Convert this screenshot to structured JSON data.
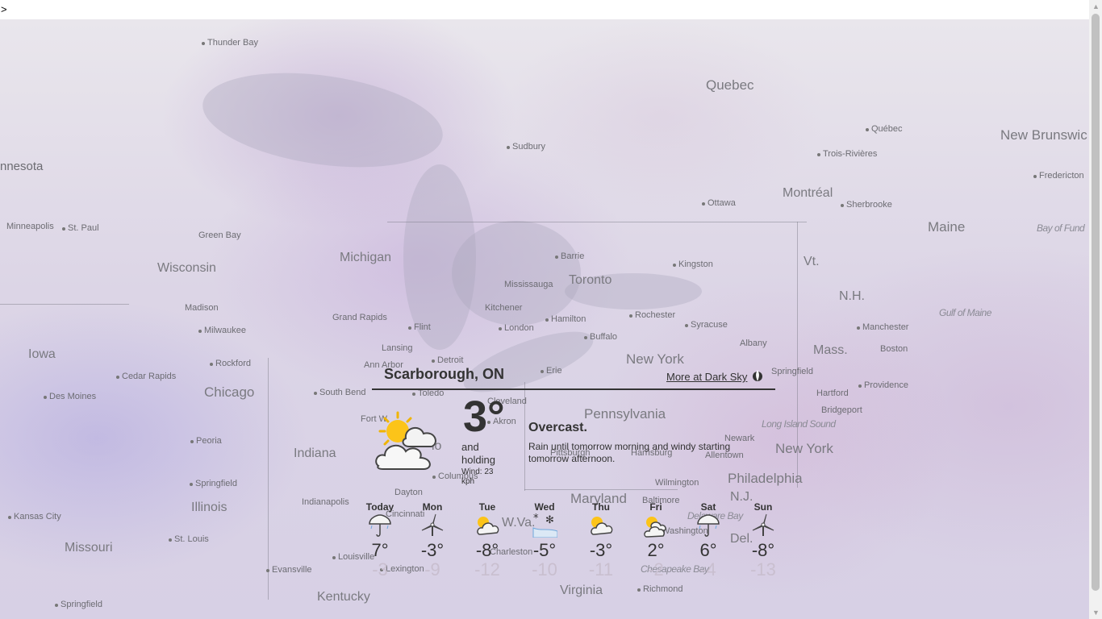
{
  "topbar": {
    "prompt": ">"
  },
  "map": {
    "labels": {
      "thunder_bay": "Thunder Bay",
      "quebec_prov": "Quebec",
      "quebec_city": "Québec",
      "new_brunswick": "New Brunswic",
      "minnesota": "nnesota",
      "sudbury": "Sudbury",
      "trois_rivieres": "Trois-Rivières",
      "fredericton": "Fredericton",
      "montreal": "Montréal",
      "ottawa": "Ottawa",
      "sherbrooke": "Sherbrooke",
      "minneapolis": "Minneapolis",
      "st_paul": "St. Paul",
      "maine": "Maine",
      "bay_of_fundy": "Bay of Fund",
      "green_bay": "Green Bay",
      "barrie": "Barrie",
      "wisconsin": "Wisconsin",
      "michigan": "Michigan",
      "kingston": "Kingston",
      "vermont": "Vt.",
      "toronto": "Toronto",
      "mississauga": "Mississauga",
      "nh": "N.H.",
      "madison": "Madison",
      "kitchener": "Kitchener",
      "hamilton": "Hamilton",
      "rochester": "Rochester",
      "gulf_of_maine": "Gulf of Maine",
      "grand_rapids": "Grand Rapids",
      "milwaukee": "Milwaukee",
      "flint": "Flint",
      "london": "London",
      "buffalo": "Buffalo",
      "syracuse": "Syracuse",
      "manchester": "Manchester",
      "lansing": "Lansing",
      "albany": "Albany",
      "iowa": "Iowa",
      "mass": "Mass.",
      "boston": "Boston",
      "rockford": "Rockford",
      "detroit": "Detroit",
      "ann_arbor": "Ann Arbor",
      "new_york_state": "New York",
      "cedar_rapids": "Cedar Rapids",
      "springfield_ma": "Springfield",
      "erie": "Erie",
      "chicago": "Chicago",
      "hartford": "Hartford",
      "providence": "Providence",
      "toledo": "Toledo",
      "south_bend": "South Bend",
      "des_moines": "Des Moines",
      "cleveland": "Cleveland",
      "bridgeport": "Bridgeport",
      "pennsylvania": "Pennsylvania",
      "fort_wayne": "Fort W",
      "akron": "Akron",
      "long_island_sound": "Long Island Sound",
      "ohio": "io",
      "newark": "Newark",
      "new_york_city": "New York",
      "peoria": "Peoria",
      "pittsburgh": "Pittsburgh",
      "harrisburg": "Harrisburg",
      "allentown": "Allentown",
      "indiana": "Indiana",
      "columbus": "Columbus",
      "philadelphia": "Philadelphia",
      "springfield_il": "Springfield",
      "dayton": "Dayton",
      "wilmington": "Wilmington",
      "illinois": "Illinois",
      "nj": "N.J.",
      "indianapolis": "Indianapolis",
      "maryland": "Maryland",
      "baltimore": "Baltimore",
      "cincinnati": "Cincinnati",
      "kansas_city": "Kansas City",
      "delaware_bay": "Delaware Bay",
      "wva": "W.Va.",
      "washington": "Washington",
      "st_louis": "St. Louis",
      "del": "Del.",
      "missouri": "Missouri",
      "charleston": "Charleston",
      "louisville": "Louisville",
      "chesapeake_bay": "Chesapeake Bay",
      "lexington": "Lexington",
      "evansville": "Evansville",
      "kentucky": "Kentucky",
      "virginia": "Virginia",
      "richmond": "Richmond",
      "springfield_mo": "Springfield"
    }
  },
  "widget": {
    "location": "Scarborough, ON",
    "more_link": "More at Dark Sky",
    "current_icon": "partly-cloudy-day-icon",
    "temperature": "3°",
    "trend_line1": "and",
    "trend_line2": "holding",
    "wind": "Wind: 23 kph",
    "summary": "Overcast.",
    "detail": "Rain until tomorrow morning and windy starting tomorrow afternoon.",
    "forecast": [
      {
        "day": "Today",
        "icon": "rain-icon",
        "high": "7°",
        "low": "-3"
      },
      {
        "day": "Mon",
        "icon": "wind-icon",
        "high": "-3°",
        "low": "-9"
      },
      {
        "day": "Tue",
        "icon": "partly-cloudy-day-icon",
        "high": "-8°",
        "low": "-12"
      },
      {
        "day": "Wed",
        "icon": "snow-icon",
        "high": "-5°",
        "low": "-10"
      },
      {
        "day": "Thu",
        "icon": "partly-cloudy-day-icon",
        "high": "-3°",
        "low": "-11"
      },
      {
        "day": "Fri",
        "icon": "partly-cloudy-day-icon",
        "high": "2°",
        "low": "-2"
      },
      {
        "day": "Sat",
        "icon": "rain-icon",
        "high": "6°",
        "low": "-4"
      },
      {
        "day": "Sun",
        "icon": "wind-icon",
        "high": "-8°",
        "low": "-13"
      }
    ]
  }
}
